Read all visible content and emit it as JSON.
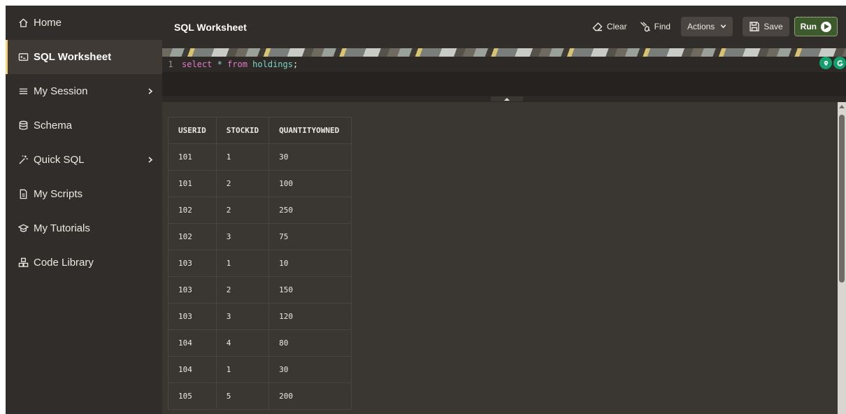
{
  "sidebar": {
    "items": [
      {
        "label": "Home",
        "icon": "home-icon"
      },
      {
        "label": "SQL Worksheet",
        "icon": "terminal-icon"
      },
      {
        "label": "My Session",
        "icon": "menu-lines-icon"
      },
      {
        "label": "Schema",
        "icon": "database-icon"
      },
      {
        "label": "Quick SQL",
        "icon": "magic-wand-icon"
      },
      {
        "label": "My Scripts",
        "icon": "document-icon"
      },
      {
        "label": "My Tutorials",
        "icon": "graduation-cap-icon"
      },
      {
        "label": "Code Library",
        "icon": "blocks-icon"
      }
    ],
    "active": "SQL Worksheet",
    "accent": "#f1d37c"
  },
  "header": {
    "title": "SQL Worksheet",
    "clear_label": "Clear",
    "find_label": "Find",
    "actions_label": "Actions",
    "save_label": "Save",
    "run_label": "Run"
  },
  "editor": {
    "line_number": "1",
    "tokens": {
      "kw1": "select",
      "star": " * ",
      "kw2": "from",
      "table": " holdings",
      "end": ";"
    }
  },
  "results": {
    "columns": [
      "USERID",
      "STOCKID",
      "QUANTITYOWNED"
    ],
    "rows": [
      [
        "101",
        "1",
        "30"
      ],
      [
        "101",
        "2",
        "100"
      ],
      [
        "102",
        "2",
        "250"
      ],
      [
        "102",
        "3",
        "75"
      ],
      [
        "103",
        "1",
        "10"
      ],
      [
        "103",
        "2",
        "150"
      ],
      [
        "103",
        "3",
        "120"
      ],
      [
        "104",
        "4",
        "80"
      ],
      [
        "104",
        "1",
        "30"
      ],
      [
        "105",
        "5",
        "200"
      ]
    ]
  },
  "colors": {
    "sidebar_bg": "#312d2a",
    "main_bg": "#3a3632",
    "run_bg": "#3d5a2d"
  }
}
